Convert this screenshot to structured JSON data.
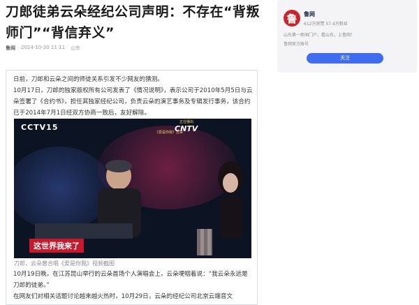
{
  "article": {
    "title": "刀郎徒弟云朵经纪公司声明：不存在“背叛师门”“背信弃义”",
    "source": "鲁网",
    "datetime": "2024-10-30 11:11",
    "region": "山东",
    "paragraphs": [
      "日前，刀郎和云朵之间的师徒关系引发不少网友的猜测。",
      "10月17日，刀郎的独家版权所有公司发表了《情况说明》，表示公司于2010年5月5日与云朵签署了《合约书》，担任其独家经纪公司，负责云朵的演艺事务及专辑发行事务，该合约已于2014年7月1日经双方协商一致后，友好解除。",
      "10月19日晚，在江苏昆山举行的云朵首场个人演唱会上，云朵哽咽着说：“我云朵永远是刀郎的徒弟。”",
      "在网友们对相关话题讨论越来越火热时，10月29日，云朵的经纪公司北京云端音文"
    ],
    "video_caption": "刀郎、云朵曾合唱《爱是你我》视频截图",
    "video_overlay": {
      "channel_logo": "CCTV15",
      "channel_logo_right": "CNTV",
      "live_text": "正在播出",
      "subtitle": "《爱是你我》云朵",
      "banner": "这世界我来了"
    }
  },
  "account": {
    "name": "鲁网",
    "stats": "612万获赞 57.4万粉丝",
    "desc1": "山东第一新闻门户，看山东，上鲁网！",
    "desc2": "鲁网官方账号",
    "follow_label": "关注",
    "logo_char": "鲁"
  }
}
